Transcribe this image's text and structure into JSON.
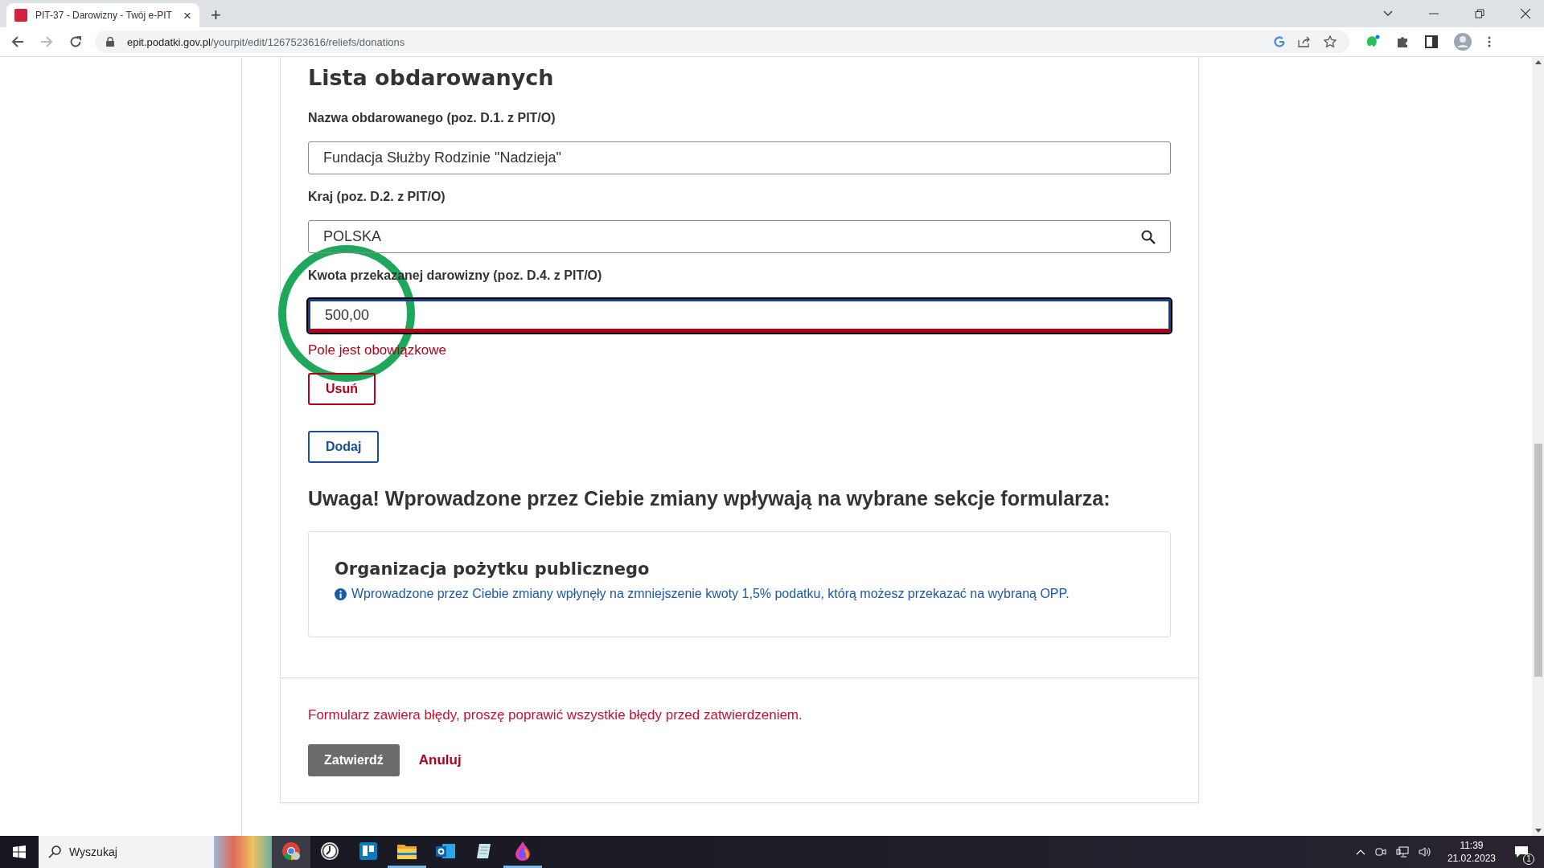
{
  "browser": {
    "tab": {
      "title": "PIT-37 - Darowizny - Twój e-PIT",
      "close": "×"
    },
    "new_tab": "+",
    "url": {
      "domain": "epit.podatki.gov.pl",
      "path": "/yourpit/edit/1267523616/reliefs/donations"
    }
  },
  "form": {
    "heading": "Lista obdarowanych",
    "fields": [
      {
        "kind": "text",
        "label": "Nazwa obdarowanego (poz. D.1. z PIT/O)",
        "value": "Fundacja Służby Rodzinie \"Nadzieja\"",
        "invalid": false
      },
      {
        "kind": "search",
        "label": "Kraj (poz. D.2. z PIT/O)",
        "value": "POLSKA",
        "invalid": false
      },
      {
        "kind": "text",
        "label": "Kwota przekazanej darowizny (poz. D.4. z PIT/O)",
        "value": "500,00",
        "invalid": true,
        "error": "Pole jest obowiązkowe"
      }
    ],
    "remove_button": "Usuń",
    "add_button": "Dodaj",
    "notice_heading": "Uwaga! Wprowadzone przez Ciebie zmiany wpływają na wybrane sekcje formularza:",
    "affected_section": {
      "title": "Organizacja pożytku publicznego",
      "info": "Wprowadzone przez Ciebie zmiany wpłynęły na zmniejszenie kwoty 1,5% podatku, którą możesz przekazać na wybraną OPP."
    },
    "form_error": "Formularz zawiera błędy, proszę poprawić wszystkie błędy przed zatwierdzeniem.",
    "submit_button": "Zatwierdź",
    "cancel_button": "Anuluj"
  },
  "taskbar": {
    "search_placeholder": "Wyszukaj",
    "apps": [
      {
        "kind": "chrome",
        "selected": true,
        "open": false
      },
      {
        "kind": "clock",
        "selected": false,
        "open": false
      },
      {
        "kind": "board",
        "selected": false,
        "open": false
      },
      {
        "kind": "folder",
        "selected": false,
        "open": true
      },
      {
        "kind": "mail",
        "selected": false,
        "open": false
      },
      {
        "kind": "notepad",
        "selected": false,
        "open": false
      },
      {
        "kind": "drop",
        "selected": false,
        "open": true
      }
    ],
    "time": "11:39",
    "date": "21.02.2023",
    "notifications": "1"
  }
}
